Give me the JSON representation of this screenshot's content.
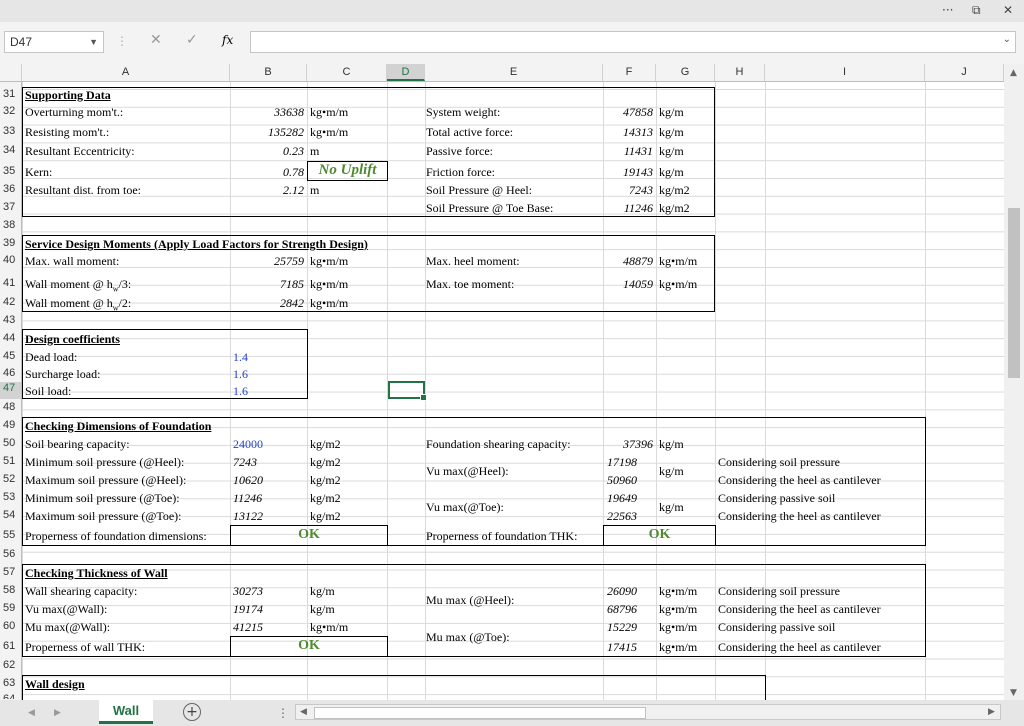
{
  "window": {
    "more": "···",
    "restore": "⧉",
    "close": "✕"
  },
  "formula_bar": {
    "name_box": "D47",
    "cancel": "✕",
    "enter": "✓",
    "fx": "fx",
    "formula": ""
  },
  "columns": [
    "A",
    "B",
    "C",
    "D",
    "E",
    "F",
    "G",
    "H",
    "I",
    "J"
  ],
  "rows": [
    "31",
    "32",
    "33",
    "34",
    "35",
    "36",
    "37",
    "38",
    "39",
    "40",
    "41",
    "42",
    "43",
    "44",
    "45",
    "46",
    "47",
    "48",
    "49",
    "50",
    "51",
    "52",
    "53",
    "54",
    "55",
    "56",
    "57",
    "58",
    "59",
    "60",
    "61",
    "62",
    "63",
    "64"
  ],
  "supporting": {
    "title": "Supporting Data",
    "overturning": {
      "label": "Overturning mom't.:",
      "value": "33638",
      "unit": "kg•m/m"
    },
    "resisting": {
      "label": "Resisting mom't.:",
      "value": "135282",
      "unit": "kg•m/m"
    },
    "eccentricity": {
      "label": "Resultant Eccentricity:",
      "value": "0.23",
      "unit": "m"
    },
    "kern": {
      "label": "Kern:",
      "value": "0.78",
      "status": "No Uplift"
    },
    "toe_dist": {
      "label": "Resultant dist. from toe:",
      "value": "2.12",
      "unit": "m"
    },
    "system_weight": {
      "label": "System weight:",
      "value": "47858",
      "unit": "kg/m"
    },
    "active": {
      "label": "Total active force:",
      "value": "14313",
      "unit": "kg/m"
    },
    "passive": {
      "label": "Passive force:",
      "value": "11431",
      "unit": "kg/m"
    },
    "friction": {
      "label": "Friction force:",
      "value": "19143",
      "unit": "kg/m"
    },
    "heel_pressure": {
      "label": "Soil Pressure @ Heel:",
      "value": "7243",
      "unit": "kg/m2"
    },
    "toe_pressure": {
      "label": "Soil Pressure @ Toe Base:",
      "value": "11246",
      "unit": "kg/m2"
    }
  },
  "service": {
    "title": "Service Design Moments (Apply Load Factors for Strength Design)",
    "max_wall": {
      "label": "Max. wall moment:",
      "value": "25759",
      "unit": "kg•m/m"
    },
    "wall_h3": {
      "label": "Wall moment @ h",
      "sub": "w",
      "tail": "/3:",
      "value": "7185",
      "unit": "kg•m/m"
    },
    "wall_h2": {
      "label": "Wall moment @ h",
      "sub": "w",
      "tail": "/2:",
      "value": "2842",
      "unit": "kg•m/m"
    },
    "max_heel": {
      "label": "Max. heel moment:",
      "value": "48879",
      "unit": "kg•m/m"
    },
    "max_toe": {
      "label": "Max. toe moment:",
      "value": "14059",
      "unit": "kg•m/m"
    }
  },
  "coeff": {
    "title": "Design coefficients",
    "dead": {
      "label": "Dead load:",
      "value": "1.4"
    },
    "surcharge": {
      "label": "Surcharge load:",
      "value": "1.6"
    },
    "soil": {
      "label": "Soil load:",
      "value": "1.6"
    }
  },
  "foundation": {
    "title": "Checking Dimensions of Foundation",
    "bearing": {
      "label": "Soil bearing capacity:",
      "value": "24000",
      "unit": "kg/m2"
    },
    "min_heel": {
      "label": "Minimum soil pressure (@Heel):",
      "value": "7243",
      "unit": "kg/m2"
    },
    "max_heel": {
      "label": "Maximum soil pressure (@Heel):",
      "value": "10620",
      "unit": "kg/m2"
    },
    "min_toe": {
      "label": "Minimum soil pressure (@Toe):",
      "value": "11246",
      "unit": "kg/m2"
    },
    "max_toe": {
      "label": "Maximum soil pressure (@Toe):",
      "value": "13122",
      "unit": "kg/m2"
    },
    "properness": {
      "label": "Properness of foundation dimensions:",
      "status": "OK"
    },
    "shear_cap": {
      "label": "Foundation shearing capacity:",
      "value": "37396",
      "unit": "kg/m"
    },
    "vu_heel": {
      "label": "Vu max(@Heel):",
      "v1": "17198",
      "v2": "50960",
      "unit": "kg/m"
    },
    "vu_toe": {
      "label": "Vu max(@Toe):",
      "v1": "19649",
      "v2": "22563",
      "unit": "kg/m"
    },
    "notes": [
      "Considering soil pressure",
      "Considering the heel as cantilever",
      "Considering passive soil",
      "Considering the heel as cantilever"
    ],
    "thk": {
      "label": "Properness of foundation THK:",
      "status": "OK"
    }
  },
  "wall": {
    "title": "Checking Thickness of Wall",
    "shear_cap": {
      "label": "Wall shearing capacity:",
      "value": "30273",
      "unit": "kg/m"
    },
    "vu": {
      "label": "Vu max(@Wall):",
      "value": "19174",
      "unit": "kg/m"
    },
    "mu": {
      "label": "Mu max(@Wall):",
      "value": "41215",
      "unit": "kg•m/m"
    },
    "thk": {
      "label": "Properness of wall THK:",
      "status": "OK"
    },
    "mu_heel": {
      "label": "Mu max (@Heel):",
      "v1": "26090",
      "v2": "68796",
      "unit": "kg•m/m"
    },
    "mu_toe": {
      "label": "Mu max (@Toe):",
      "v1": "15229",
      "v2": "17415",
      "unit": "kg•m/m"
    },
    "notes": [
      "Considering soil pressure",
      "Considering the heel as cantilever",
      "Considering passive soil",
      "Considering the heel as cantilever"
    ]
  },
  "wall_design": {
    "title": "Wall design"
  },
  "sheet_tab": "Wall"
}
